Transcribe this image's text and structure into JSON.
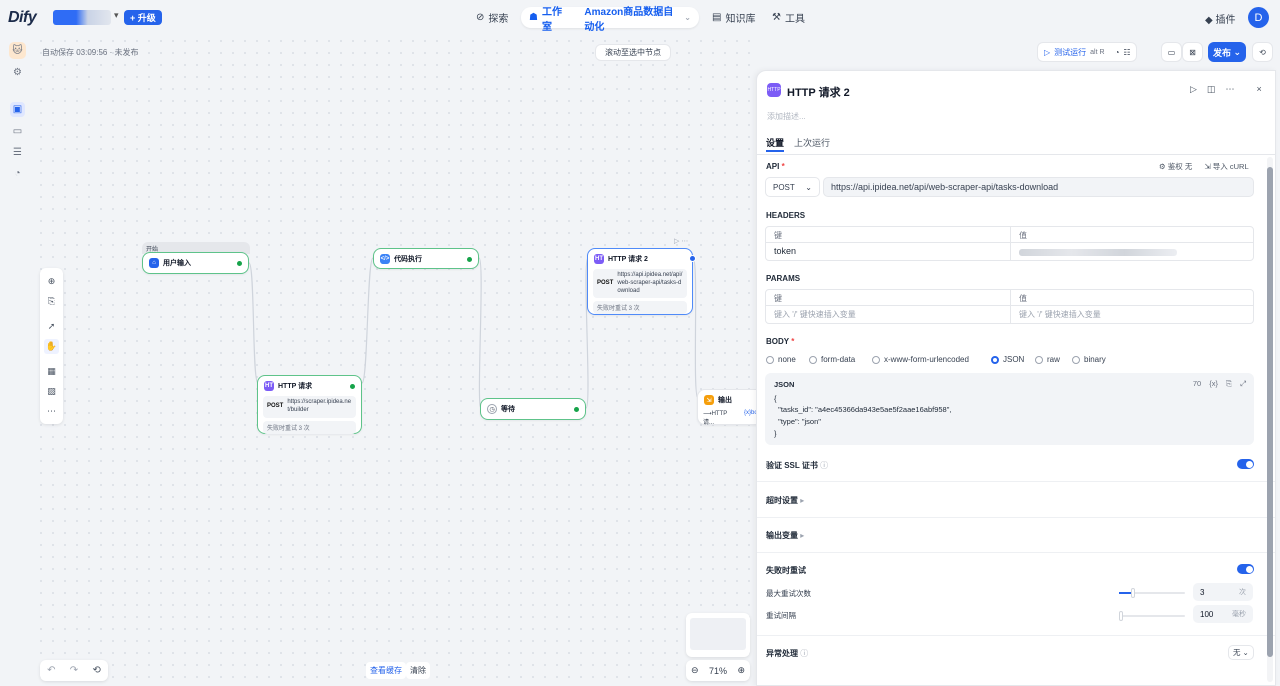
{
  "topbar": {
    "logo": "Dify",
    "upgrade": "+ 升级",
    "nav_explore": "探索",
    "nav_studio": "工作室",
    "app_name": "Amazon商品数据自动化",
    "nav_knowledge": "知识库",
    "nav_tools": "工具",
    "plugins": "插件",
    "avatar": "D"
  },
  "canvas": {
    "autosave": "自动保存 03:09:56 · 未发布",
    "scroll_selected": "滚动至选中节点",
    "start_tag": "开始",
    "zoom": "71%",
    "view_cache": "查看缓存",
    "clear": "清除",
    "test_run": "测试运行",
    "test_run_shortcut": "alt  R",
    "publish": "发布"
  },
  "nodes": {
    "user_input": "用户输入",
    "http1_title": "HTTP 请求",
    "http1_method": "POST",
    "http1_url": "https://scraper.ipidea.net/builder",
    "http1_retry": "失败时重试 3 次",
    "code_exec": "代码执行",
    "wait": "等待",
    "http2_title": "HTTP 请求 2",
    "http2_method": "POST",
    "http2_url": "https://api.ipidea.net/api/web-scraper-api/tasks-download",
    "http2_retry": "失败时重试 3 次",
    "output": "输出",
    "output_ref": "⟶HTTP 请...",
    "output_var": "{x}bod"
  },
  "panel": {
    "title": "HTTP 请求 2",
    "desc_placeholder": "添加描述...",
    "tab_settings": "设置",
    "tab_last_run": "上次运行",
    "api_label": "API",
    "auth": "鉴权 无",
    "import_curl": "导入 cURL",
    "method": "POST",
    "url": "https://api.ipidea.net/api/web-scraper-api/tasks-download",
    "headers_label": "HEADERS",
    "col_key": "键",
    "col_value": "值",
    "header_key": "token",
    "params_label": "PARAMS",
    "param_key_placeholder": "键入 '/' 键快速插入变量",
    "param_value_placeholder": "键入 '/' 键快速插入变量",
    "body_label": "BODY",
    "body_types": [
      "none",
      "form-data",
      "x-www-form-urlencoded",
      "JSON",
      "raw",
      "binary"
    ],
    "json_label": "JSON",
    "json_count": "70",
    "json_lines": [
      "{",
      "  \"tasks_id\": \"a4ec45366da943e5ae5f2aae16abf958\",",
      "  \"type\": \"json\"",
      "}"
    ],
    "ssl_label": "验证 SSL 证书",
    "timeout_label": "超时设置",
    "output_vars_label": "输出变量",
    "retry_label": "失败时重试",
    "max_retries_label": "最大重试次数",
    "max_retries_value": "3",
    "max_retries_unit": "次",
    "retry_interval_label": "重试间隔",
    "retry_interval_value": "100",
    "retry_interval_unit": "毫秒",
    "error_handling_label": "异常处理",
    "error_handling_value": "无"
  },
  "colors": {
    "accent": "#2563eb",
    "success": "#16a34a",
    "node_purple": "#7c5cf6"
  }
}
